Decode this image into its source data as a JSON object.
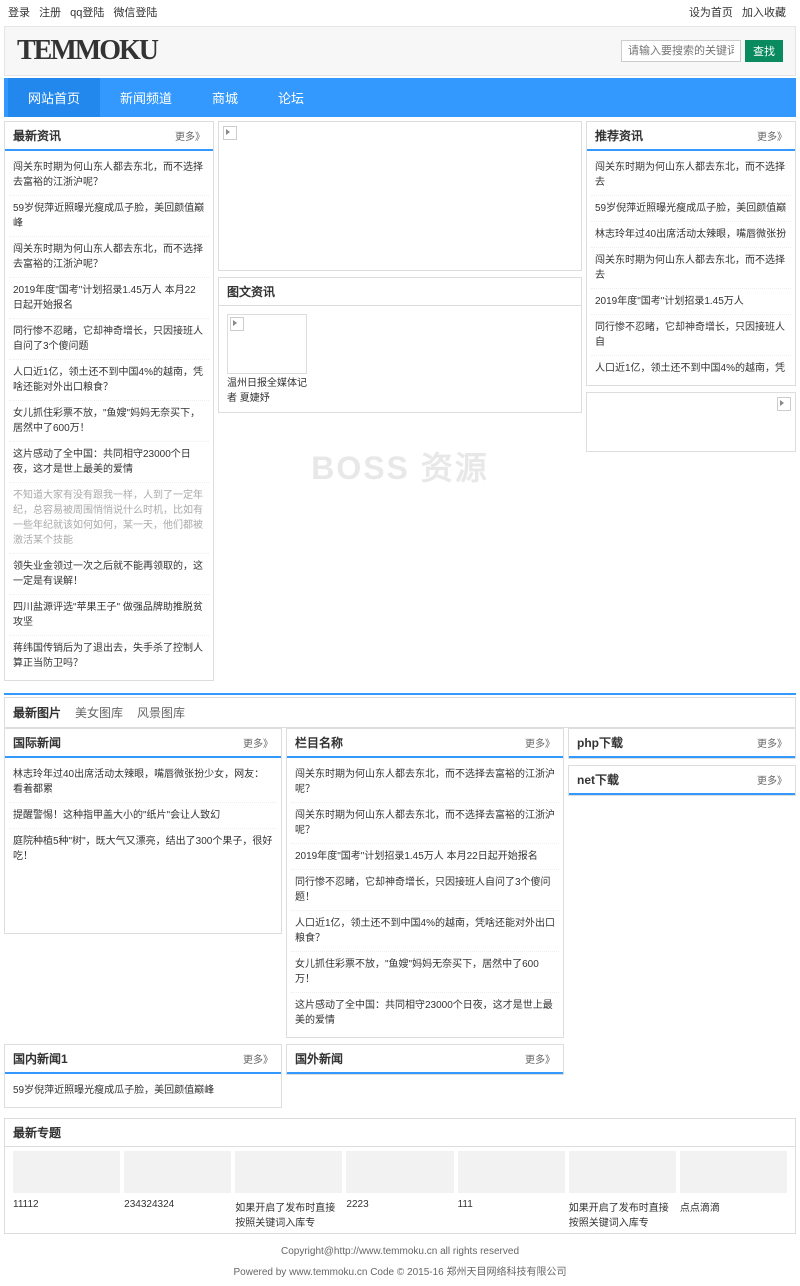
{
  "topbar": {
    "left": [
      "登录",
      "注册",
      "qq登陆",
      "微信登陆"
    ],
    "right": [
      "设为首页",
      "加入收藏"
    ]
  },
  "header": {
    "logo": "TEMMOKU",
    "search_placeholder": "请输入要搜索的关键词",
    "search_btn": "查找"
  },
  "nav": [
    "网站首页",
    "新闻频道",
    "商城",
    "论坛"
  ],
  "more_label": "更多》",
  "latest_news": {
    "title": "最新资讯",
    "items": [
      "闯关东时期为何山东人都去东北，而不选择去富裕的江浙沪呢？",
      "59岁倪萍近照曝光瘦成瓜子脸，美回颜值巅峰",
      "闯关东时期为何山东人都去东北，而不选择去富裕的江浙沪呢？",
      "2019年度\"国考\"计划招录1.45万人 本月22日起开始报名",
      "同行惨不忍睹，它却神奇增长，只因接班人自问了3个傻问题",
      "人口近1亿，领土还不到中国4%的越南，凭啥还能对外出口粮食？",
      "女儿抓住彩票不放，\"鱼嫂\"妈妈无奈买下，居然中了600万！",
      "这片感动了全中国：共同相守23000个日夜，这才是世上最美的爱情"
    ],
    "gray_item": "不知道大家有没有跟我一样，人到了一定年纪，总容易被周围悄悄说什么时机，比如有一些年纪就该如何如何，某一天，他们都被激活某个技能",
    "tail_items": [
      "领失业金领过一次之后就不能再领取的，这一定是有误解！",
      "四川盐源评选\"苹果王子\" 做强品牌助推脱贫攻坚",
      "蒋纬国传销后为了退出去，失手杀了控制人算正当防卫吗？"
    ]
  },
  "img_text": {
    "title": "图文资讯",
    "caption": "温州日报全媒体记者 夏婕妤"
  },
  "recommend": {
    "title": "推荐资讯",
    "items": [
      "闯关东时期为何山东人都去东北，而不选择去",
      "59岁倪萍近照曝光瘦成瓜子脸，美回颜值巅",
      "林志玲年过40出席活动太辣眼，嘴唇微张扮",
      "闯关东时期为何山东人都去东北，而不选择去",
      "2019年度\"国考\"计划招录1.45万人",
      "同行惨不忍睹，它却神奇增长，只因接班人自",
      "人口近1亿，领土还不到中国4%的越南，凭"
    ]
  },
  "watermark": "BOSS 资源",
  "img_tabs": {
    "title": "最新图片",
    "tabs": [
      "美女图库",
      "风景图库"
    ]
  },
  "intl_news": {
    "title": "国际新闻",
    "items": [
      "林志玲年过40出席活动太辣眼，嘴唇微张扮少女，网友：看着都累",
      "提醒警惕！这种指甲盖大小的\"纸片\"会让人致幻",
      "庭院种植5种\"树\"，既大气又漂亮，结出了300个果子，很好吃！"
    ]
  },
  "col_name": {
    "title": "栏目名称",
    "items": [
      "闯关东时期为何山东人都去东北，而不选择去富裕的江浙沪呢？",
      "闯关东时期为何山东人都去东北，而不选择去富裕的江浙沪呢？",
      "2019年度\"国考\"计划招录1.45万人 本月22日起开始报名",
      "同行惨不忍睹，它却神奇增长，只因接班人自问了3个傻问题！",
      "人口近1亿，领土还不到中国4%的越南，凭啥还能对外出口粮食？",
      "女儿抓住彩票不放，\"鱼嫂\"妈妈无奈买下，居然中了600万！",
      "这片感动了全中国：共同相守23000个日夜，这才是世上最美的爱情"
    ]
  },
  "php_dl": {
    "title": "php下载"
  },
  "net_dl": {
    "title": "net下载"
  },
  "domestic": {
    "title": "国内新闻1",
    "items": [
      "59岁倪萍近照曝光瘦成瓜子脸，美回颜值巅峰"
    ]
  },
  "foreign": {
    "title": "国外新闻"
  },
  "special": {
    "title": "最新专题",
    "items": [
      "11112",
      "234324324",
      "如果开启了发布时直接按照关键词入库专",
      "2223",
      "111",
      "如果开启了发布时直接按照关键词入库专",
      "点点滴滴"
    ]
  },
  "footer": {
    "copyright": "Copyright@http://www.temmoku.cn all rights reserved",
    "powered": "Powered by www.temmoku.cn Code © 2015-16 郑州天目网络科技有限公司"
  }
}
